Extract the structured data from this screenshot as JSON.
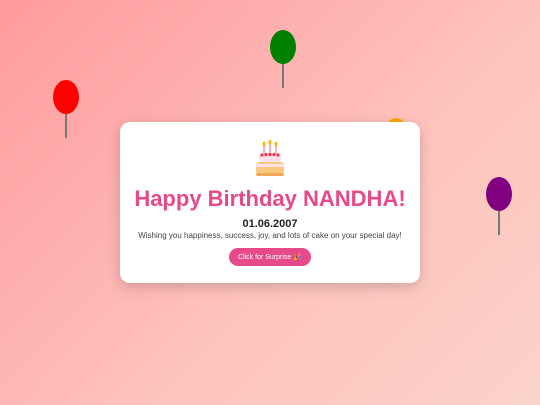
{
  "card": {
    "title": "Happy Birthday NANDHA!",
    "date": "01.06.2007",
    "message": "Wishing you happiness, success, joy, and lots of cake on your special day!",
    "button_label": "Click for Surprise",
    "button_icon": "🎉",
    "cake_icon": "birthday-cake-icon"
  },
  "balloons": [
    {
      "color": "#ff0000"
    },
    {
      "color": "#008000"
    },
    {
      "color": "#800080"
    },
    {
      "color": "#ffa500"
    }
  ],
  "colors": {
    "accent": "#e64a8a",
    "background_start": "#ff9a9e",
    "background_end": "#fbd3c9"
  }
}
